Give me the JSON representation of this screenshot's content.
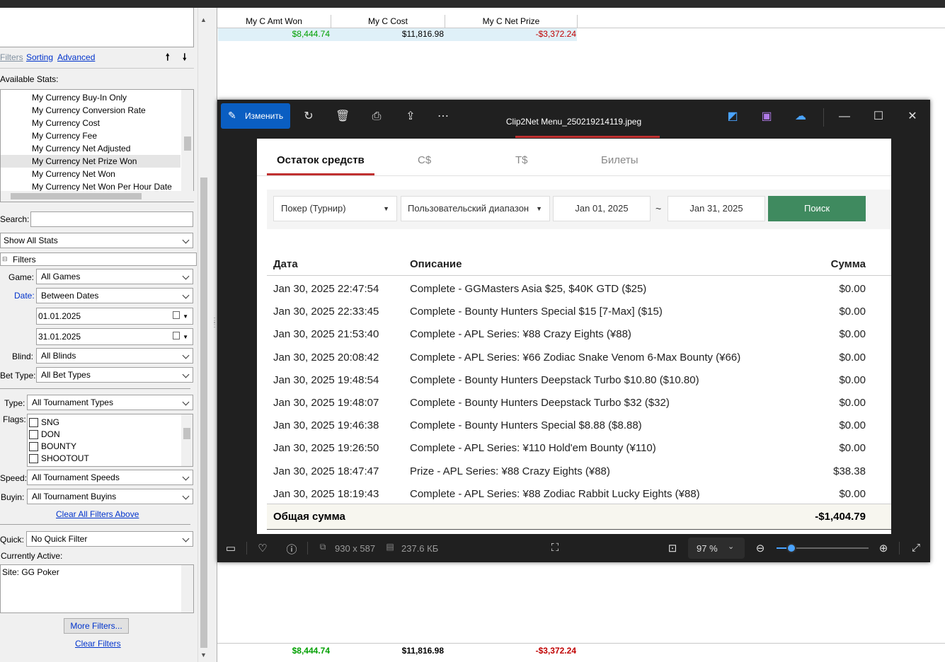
{
  "top_table": {
    "headers": [
      "My C Amt Won",
      "My C Cost",
      "My C Net Prize"
    ],
    "row": {
      "amt_won": "$8,444.74",
      "cost": "$11,816.98",
      "net": "-$3,372.24"
    },
    "totals": {
      "amt_won": "$8,444.74",
      "cost": "$11,816.98",
      "net": "-$3,372.24"
    }
  },
  "left_panel": {
    "links": {
      "filters": "Filters",
      "sorting": "Sorting",
      "advanced": "Advanced"
    },
    "available_stats_label": "Available Stats:",
    "stats": [
      "My Currency Buy-In Only",
      "My Currency Conversion Rate",
      "My Currency Cost",
      "My Currency Fee",
      "My Currency Net Adjusted",
      "My Currency Net Prize Won",
      "My Currency Net Won",
      "My Currency Net Won Per Hour Date"
    ],
    "search_label": "Search:",
    "show_all": "Show All Stats",
    "filters_section": "Filters",
    "game_label": "Game:",
    "game_value": "All Games",
    "date_label": "Date:",
    "date_value": "Between Dates",
    "date_from": "01.01.2025",
    "date_to": "31.01.2025",
    "blind_label": "Blind:",
    "blind_value": "All Blinds",
    "bettype_label": "Bet Type:",
    "bettype_value": "All Bet Types",
    "type_label": "Type:",
    "type_value": "All Tournament Types",
    "flags_label": "Flags:",
    "flags": [
      "SNG",
      "DON",
      "BOUNTY",
      "SHOOTOUT"
    ],
    "speed_label": "Speed:",
    "speed_value": "All Tournament Speeds",
    "buyin_label": "Buyin:",
    "buyin_value": "All Tournament Buyins",
    "clear_above": "Clear All Filters Above",
    "quick_label": "Quick:",
    "quick_value": "No Quick Filter",
    "currently_active_label": "Currently Active:",
    "currently_active_value": "Site: GG Poker",
    "more_filters": "More Filters...",
    "clear_filters": "Clear Filters"
  },
  "viewer": {
    "edit_label": "Изменить",
    "title": "Clip2Net Menu_250219214119.jpeg",
    "dimensions": "930 x 587",
    "filesize": "237.6 КБ",
    "zoom": "97 %",
    "zoom_level": 0.16
  },
  "document": {
    "tabs": [
      "Остаток средств",
      "C$",
      "T$",
      "Билеты"
    ],
    "game_select": "Покер (Турнир)",
    "range_select": "Пользовательский диапазон",
    "date_from": "Jan 01, 2025",
    "tilde": "~",
    "date_to": "Jan 31, 2025",
    "search_btn": "Поиск",
    "columns": {
      "date": "Дата",
      "desc": "Описание",
      "sum": "Сумма"
    },
    "rows": [
      {
        "date": "Jan 30, 2025 22:47:54",
        "desc": "Complete - GGMasters Asia $25, $40K GTD ($25)",
        "sum": "$0.00"
      },
      {
        "date": "Jan 30, 2025 22:33:45",
        "desc": "Complete - Bounty Hunters Special $15 [7-Max] ($15)",
        "sum": "$0.00"
      },
      {
        "date": "Jan 30, 2025 21:53:40",
        "desc": "Complete - APL Series: ¥88 Crazy Eights (¥88)",
        "sum": "$0.00"
      },
      {
        "date": "Jan 30, 2025 20:08:42",
        "desc": "Complete - APL Series: ¥66 Zodiac Snake Venom 6-Max Bounty (¥66)",
        "sum": "$0.00"
      },
      {
        "date": "Jan 30, 2025 19:48:54",
        "desc": "Complete - Bounty Hunters Deepstack Turbo $10.80 ($10.80)",
        "sum": "$0.00"
      },
      {
        "date": "Jan 30, 2025 19:48:07",
        "desc": "Complete - Bounty Hunters Deepstack Turbo $32 ($32)",
        "sum": "$0.00"
      },
      {
        "date": "Jan 30, 2025 19:46:38",
        "desc": "Complete - Bounty Hunters Special $8.88 ($8.88)",
        "sum": "$0.00"
      },
      {
        "date": "Jan 30, 2025 19:26:50",
        "desc": "Complete - APL Series: ¥110 Hold'em Bounty (¥110)",
        "sum": "$0.00"
      },
      {
        "date": "Jan 30, 2025 18:47:47",
        "desc": "Prize - APL Series: ¥88 Crazy Eights (¥88)",
        "sum": "$38.38"
      },
      {
        "date": "Jan 30, 2025 18:19:43",
        "desc": "Complete - APL Series: ¥88 Zodiac Rabbit Lucky Eights (¥88)",
        "sum": "$0.00"
      }
    ],
    "total_label": "Общая сумма",
    "total_value": "-$1,404.79"
  }
}
